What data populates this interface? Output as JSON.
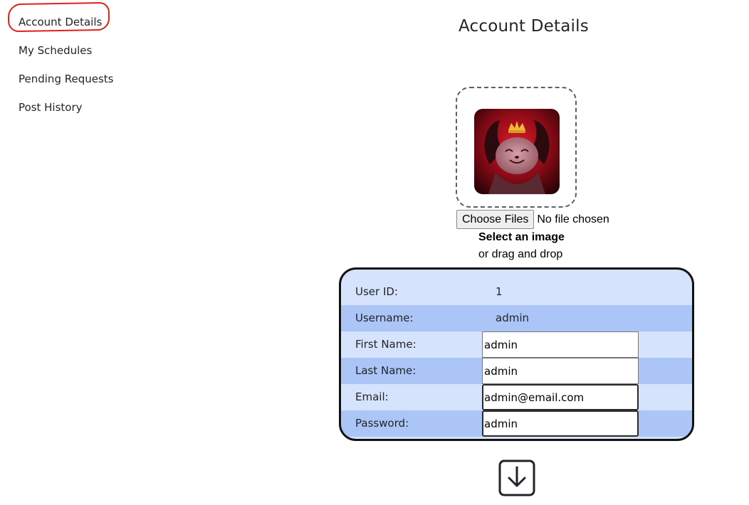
{
  "sidebar": {
    "items": [
      {
        "label": "Account Details",
        "active": true
      },
      {
        "label": "My Schedules"
      },
      {
        "label": "Pending Requests"
      },
      {
        "label": "Post History"
      }
    ]
  },
  "page": {
    "title": "Account Details"
  },
  "upload": {
    "button_label": "Choose Files",
    "status": "No file chosen",
    "prompt": "Select an image",
    "hint": "or drag and drop"
  },
  "details": {
    "user_id": {
      "label": "User ID:",
      "value": "1"
    },
    "username": {
      "label": "Username:",
      "value": "admin"
    },
    "first_name": {
      "label": "First Name:",
      "value": "admin"
    },
    "last_name": {
      "label": "Last Name:",
      "value": "admin"
    },
    "email": {
      "label": "Email:",
      "value": "admin@email.com"
    },
    "password": {
      "label": "Password:",
      "value": "admin"
    }
  },
  "colors": {
    "row_light": "#d6e3fd",
    "row_dark": "#abc5f6",
    "active_highlight": "#e0201b"
  },
  "icons": {
    "save": "download-arrow-icon"
  }
}
